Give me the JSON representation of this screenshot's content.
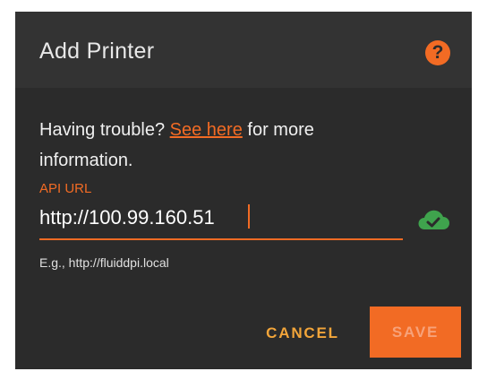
{
  "dialog": {
    "title": "Add Printer",
    "help_icon": "help-circle-icon",
    "help_glyph": "?"
  },
  "info": {
    "prefix": "Having trouble?",
    "link": "See here",
    "suffix": "for more information."
  },
  "field": {
    "label": "API URL",
    "value": "http://100.99.160.51",
    "hint": "E.g., http://fluiddpi.local",
    "status_icon": "cloud-check-icon",
    "status_color": "#3fa34d"
  },
  "actions": {
    "cancel": "CANCEL",
    "save": "SAVE"
  },
  "colors": {
    "accent": "#f26b24",
    "dialog_bg": "#2b2b2b",
    "header_bg": "#333333"
  }
}
